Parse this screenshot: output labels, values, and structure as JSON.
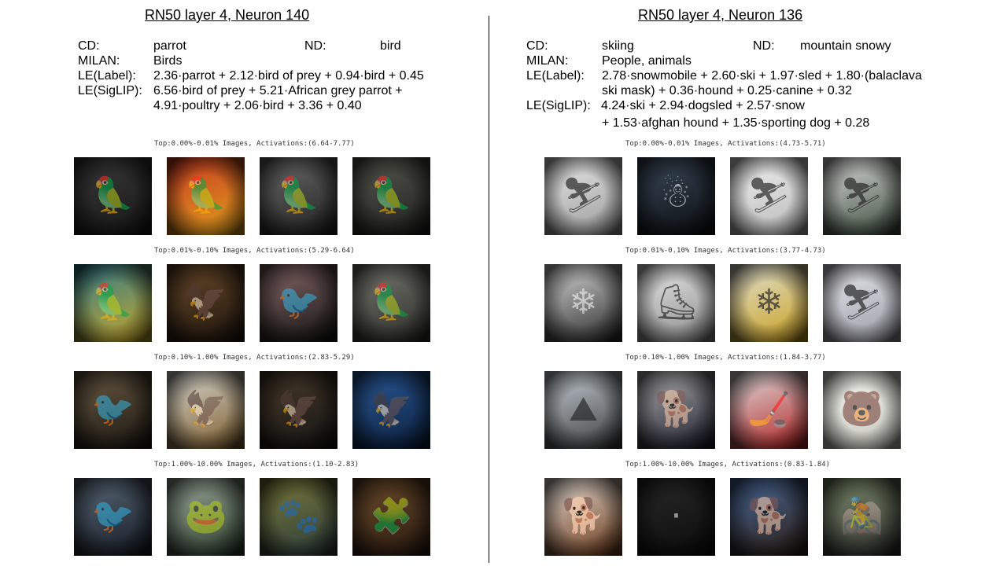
{
  "left": {
    "title": "RN50 layer 4, Neuron 140",
    "cd_key": "CD:",
    "cd_val": "parrot",
    "nd_key": "ND:",
    "nd_val": "bird",
    "milan_key": "MILAN:",
    "milan_val": "Birds",
    "lel_key": "LE(Label):",
    "lel_val": "2.36·parrot + 2.12·bird of prey + 0.94·bird + 0.45",
    "les_key": "LE(SigLIP):",
    "les_val1": "6.56·bird of prey + 5.21·African grey parrot +",
    "les_val2": "4.91·poultry  + 2.06·bird + 3.36 + 0.40",
    "groups": [
      {
        "caption": "Top:0.00%-0.01% Images, Activations:(6.64-7.77)",
        "images": [
          {
            "icon": "parrot-icon",
            "glyph": "🦜",
            "colors": [
              "#3a3a3a",
              "#161616"
            ],
            "light": false
          },
          {
            "icon": "parrot-icon",
            "glyph": "🦜",
            "colors": [
              "#c83a22",
              "#e0a01c"
            ],
            "light": false
          },
          {
            "icon": "parrot-icon",
            "glyph": "🦜",
            "colors": [
              "#6a6a6a",
              "#202020"
            ],
            "light": false
          },
          {
            "icon": "parrot-icon",
            "glyph": "🦜",
            "colors": [
              "#5a5a52",
              "#1c1c1c"
            ],
            "light": false
          }
        ]
      },
      {
        "caption": "Top:0.01%-0.10% Images, Activations:(5.29-6.64)",
        "images": [
          {
            "icon": "parrot-icon",
            "glyph": "🦜",
            "colors": [
              "#2e7a8a",
              "#c9a82a"
            ],
            "light": false
          },
          {
            "icon": "eagle-icon",
            "glyph": "🦅",
            "colors": [
              "#6a4a2a",
              "#1c140c"
            ],
            "light": false
          },
          {
            "icon": "vulture-icon",
            "glyph": "🐦",
            "colors": [
              "#8a6a6a",
              "#111111"
            ],
            "light": false
          },
          {
            "icon": "parrot-icon",
            "glyph": "🦜",
            "colors": [
              "#7a7a72",
              "#2a2a28"
            ],
            "light": false
          }
        ]
      },
      {
        "caption": "Top:0.10%-1.00% Images, Activations:(2.83-5.29)",
        "images": [
          {
            "icon": "grouse-icon",
            "glyph": "🐦",
            "colors": [
              "#6a5a44",
              "#1a1610"
            ],
            "light": false
          },
          {
            "icon": "eagle-icon",
            "glyph": "🦅",
            "colors": [
              "#d8d8d0",
              "#7a5a2a"
            ],
            "light": false
          },
          {
            "icon": "eagle-icon",
            "glyph": "🦅",
            "colors": [
              "#4a3a2a",
              "#141414"
            ],
            "light": false
          },
          {
            "icon": "kite-icon",
            "glyph": "🦅",
            "colors": [
              "#2a5a9a",
              "#0a1e3a"
            ],
            "light": false
          }
        ]
      },
      {
        "caption": "Top:1.00%-10.00% Images, Activations:(1.10-2.83)",
        "images": [
          {
            "icon": "heron-icon",
            "glyph": "🐦",
            "colors": [
              "#5a6a7a",
              "#141820"
            ],
            "light": false
          },
          {
            "icon": "frog-icon",
            "glyph": "🐸",
            "colors": [
              "#9aa89a",
              "#2a3a2a"
            ],
            "light": false
          },
          {
            "icon": "animal-icon",
            "glyph": "🐾",
            "colors": [
              "#7a7a3a",
              "#2a3a3a"
            ],
            "light": false
          },
          {
            "icon": "puzzle-icon",
            "glyph": "🧩",
            "colors": [
              "#6a4a2a",
              "#2a1a10"
            ],
            "light": false
          }
        ]
      }
    ]
  },
  "right": {
    "title": "RN50 layer 4, Neuron 136",
    "cd_key": "CD:",
    "cd_val": "skiing",
    "nd_key": "ND:",
    "nd_val": "mountain snowy",
    "milan_key": "MILAN:",
    "milan_val": "People, animals",
    "lel_key": "LE(Label):",
    "lel_val1": "2.78·snowmobile + 2.60·ski + 1.97·sled + 1.80·(balaclava",
    "lel_val2": "ski mask) + 0.36·hound + 0.25·canine + 0.32",
    "les_key": "LE(SigLIP):",
    "les_val1": "4.24·ski + 2.94·dogsled + 2.57·snow",
    "les_val2": "+ 1.53·afghan hound + 1.35·sporting dog + 0.28",
    "groups": [
      {
        "caption": "Top:0.00%-0.01% Images, Activations:(4.73-5.71)",
        "images": [
          {
            "icon": "skier-icon",
            "glyph": "⛷",
            "colors": [
              "#e8e8e8",
              "#9a9a9a"
            ],
            "light": true
          },
          {
            "icon": "balaclava-icon",
            "glyph": "☃",
            "colors": [
              "#3a4a5a",
              "#0c0c10"
            ],
            "light": false
          },
          {
            "icon": "skier-icon",
            "glyph": "⛷",
            "colors": [
              "#f0f0f0",
              "#b8b8b8"
            ],
            "light": true
          },
          {
            "icon": "skier-icon",
            "glyph": "⛷",
            "colors": [
              "#dcdcdc",
              "#3a4a3a"
            ],
            "light": true
          }
        ]
      },
      {
        "caption": "Top:0.01%-0.10% Images, Activations:(3.77-4.73)",
        "images": [
          {
            "icon": "snowmobile-icon",
            "glyph": "❄",
            "colors": [
              "#d8d8d8",
              "#2a2a2a"
            ],
            "light": false
          },
          {
            "icon": "skater-icon",
            "glyph": "⛸",
            "colors": [
              "#e8e8e8",
              "#8a8a8a"
            ],
            "light": true
          },
          {
            "icon": "snowmobile-icon",
            "glyph": "❄",
            "colors": [
              "#e0e0d0",
              "#c8a020"
            ],
            "light": true
          },
          {
            "icon": "skier-icon",
            "glyph": "⛷",
            "colors": [
              "#e8e8ee",
              "#9a9aa4"
            ],
            "light": true
          }
        ]
      },
      {
        "caption": "Top:0.10%-1.00% Images, Activations:(1.84-3.77)",
        "images": [
          {
            "icon": "mountain-icon",
            "glyph": "⛰",
            "colors": [
              "#c8d0d8",
              "#3a3a3a"
            ],
            "light": true
          },
          {
            "icon": "dog-icon",
            "glyph": "🐕",
            "colors": [
              "#b0b0b0",
              "#1a1a2a"
            ],
            "light": false
          },
          {
            "icon": "hockey-icon",
            "glyph": "🏒",
            "colors": [
              "#e0e0e0",
              "#b02020"
            ],
            "light": true
          },
          {
            "icon": "polar-bear-icon",
            "glyph": "🐻",
            "colors": [
              "#f0f0ea",
              "#c8c8c0"
            ],
            "light": true
          }
        ]
      },
      {
        "caption": "Top:1.00%-10.00% Images, Activations:(0.83-1.84)",
        "images": [
          {
            "icon": "dog-icon",
            "glyph": "🐕",
            "colors": [
              "#e0d8d0",
              "#6a3a1a"
            ],
            "light": true
          },
          {
            "icon": "dark-scene-icon",
            "glyph": "·",
            "colors": [
              "#2a2a2a",
              "#0a0a0a"
            ],
            "light": false
          },
          {
            "icon": "dog-icon",
            "glyph": "🐕",
            "colors": [
              "#4a6a9a",
              "#2a1a10"
            ],
            "light": false
          },
          {
            "icon": "cyclist-icon",
            "glyph": "🚵",
            "colors": [
              "#7a8a6a",
              "#2a2a2a"
            ],
            "light": false
          }
        ]
      }
    ]
  }
}
